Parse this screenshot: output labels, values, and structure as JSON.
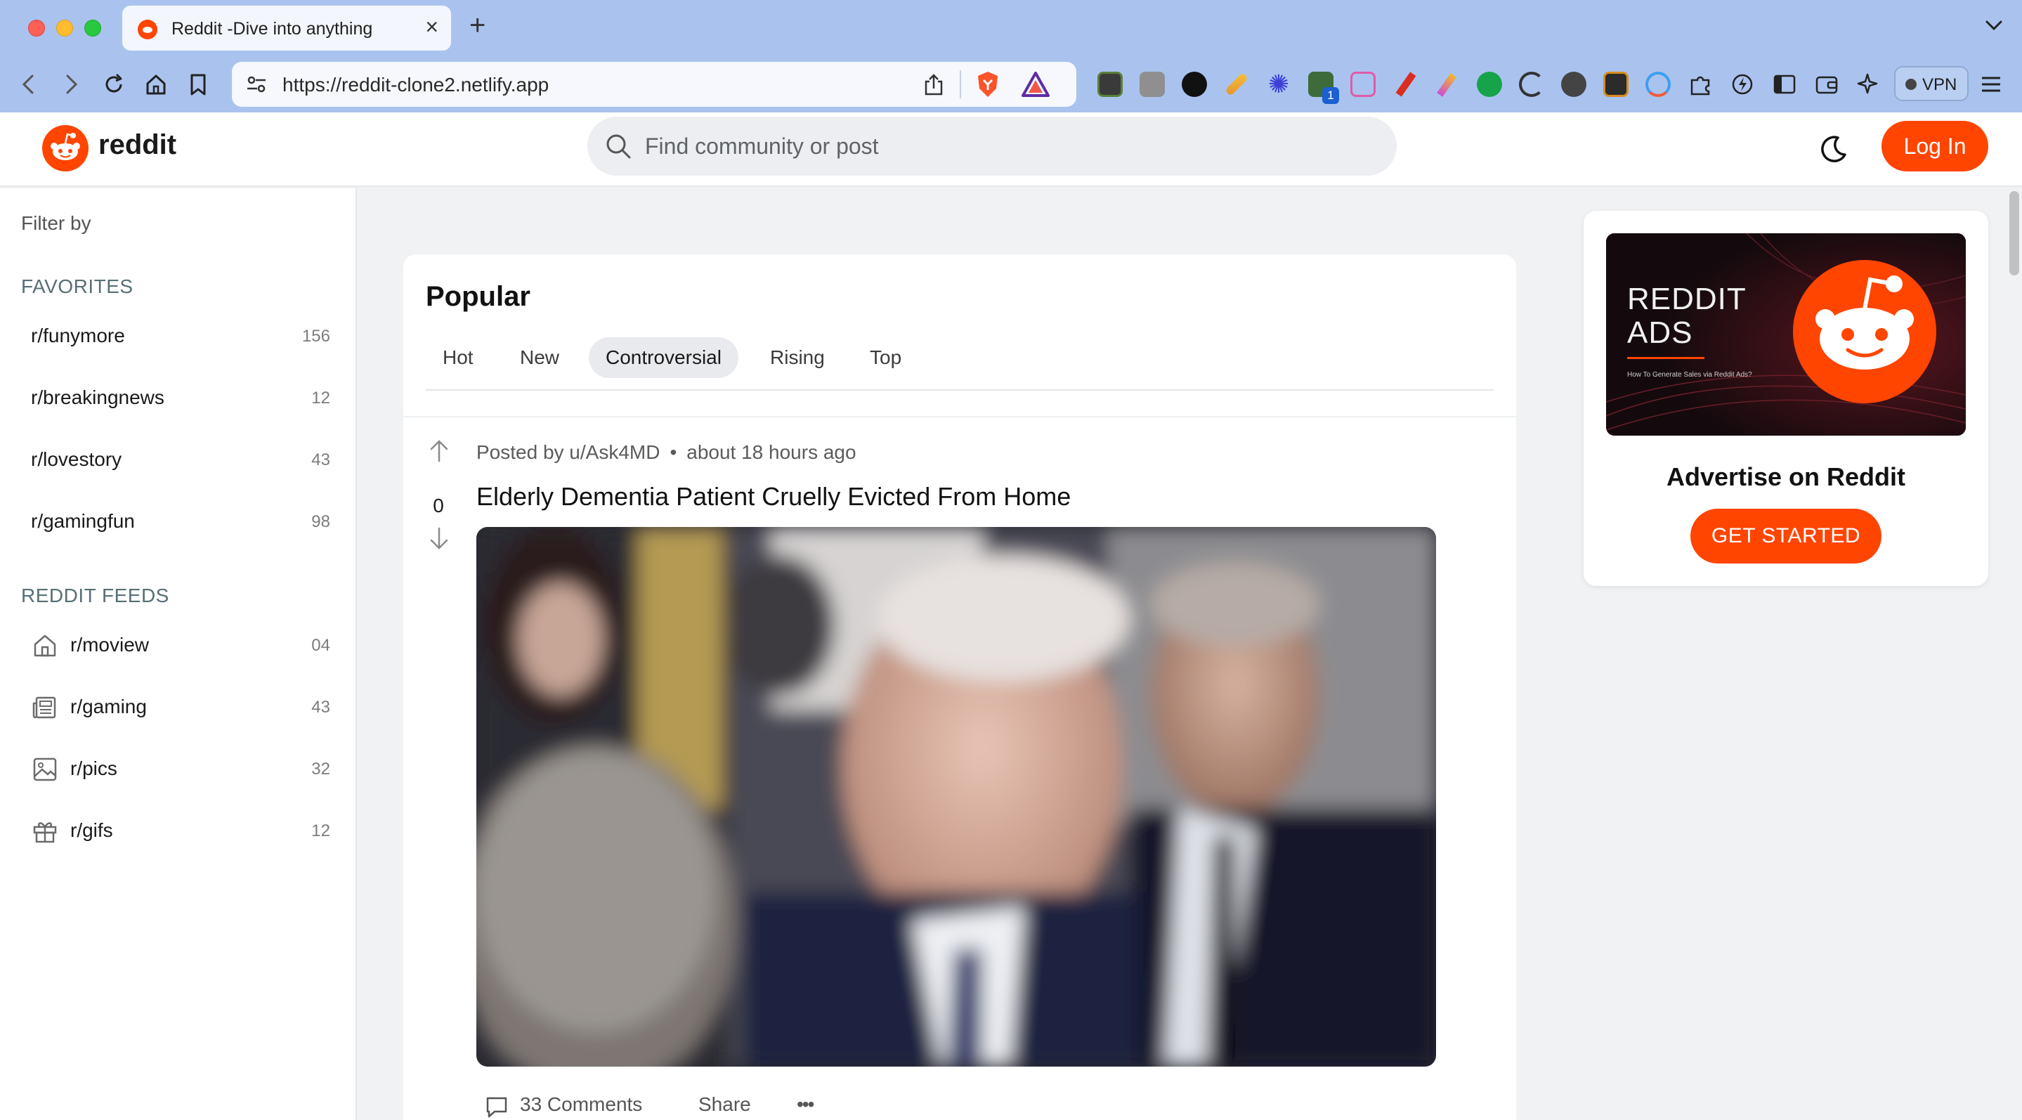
{
  "browser": {
    "tab_title": "Reddit -Dive into anything",
    "url": "https://reddit-clone2.netlify.app",
    "vpn_label": "VPN",
    "extension_badge": "1"
  },
  "header": {
    "logo_text": "reddit",
    "search_placeholder": "Find community or post",
    "login_label": "Log In"
  },
  "sidebar": {
    "filter_label": "Filter by",
    "favorites_title": "FAVORITES",
    "favorites": [
      {
        "name": "r/funymore",
        "count": "156"
      },
      {
        "name": "r/breakingnews",
        "count": "12"
      },
      {
        "name": "r/lovestory",
        "count": "43"
      },
      {
        "name": "r/gamingfun",
        "count": "98"
      }
    ],
    "feeds_title": "REDDIT FEEDS",
    "feeds": [
      {
        "name": "r/moview",
        "count": "04",
        "icon": "home-icon"
      },
      {
        "name": "r/gaming",
        "count": "43",
        "icon": "newspaper-icon"
      },
      {
        "name": "r/pics",
        "count": "32",
        "icon": "image-icon"
      },
      {
        "name": "r/gifs",
        "count": "12",
        "icon": "gift-icon"
      }
    ]
  },
  "feed": {
    "title": "Popular",
    "tabs": [
      "Hot",
      "New",
      "Controversial",
      "Rising",
      "Top"
    ],
    "active_tab": "Controversial"
  },
  "post": {
    "posted_by": "Posted by u/Ask4MD",
    "time": "about 18 hours ago",
    "votes": "0",
    "title": "Elderly Dementia Patient Cruelly Evicted From Home",
    "comments_label": "33 Comments",
    "share_label": "Share",
    "more_label": "•••"
  },
  "ad": {
    "banner_line1": "REDDIT",
    "banner_line2": "ADS",
    "banner_small": "How To Generate Sales via Reddit Ads?",
    "heading": "Advertise on Reddit",
    "cta": "GET STARTED"
  },
  "colors": {
    "accent": "#ff4500",
    "chrome": "#aac3ee",
    "page_bg": "#f1f2f4"
  }
}
